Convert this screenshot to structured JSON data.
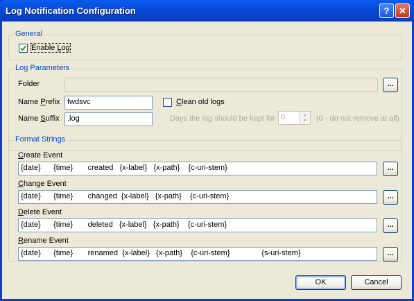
{
  "window": {
    "title": "Log Notification Configuration",
    "help_label": "?",
    "close_label": "✕"
  },
  "general": {
    "legend": "General",
    "enable_log_label": "Enable Log",
    "enable_log_checked": true
  },
  "log_parameters": {
    "legend": "Log Parameters",
    "folder_label": "Folder",
    "folder_value": "",
    "name_prefix_label": "Name Prefix",
    "name_prefix_value": "fwdsvc",
    "name_suffix_label": "Name Suffix",
    "name_suffix_value": ".log",
    "clean_old_logs_label": "Clean old logs",
    "clean_old_logs_checked": false,
    "days_label": "Days the log should be kept for",
    "days_value": "0",
    "days_hint": "(0 - do not remove at all)"
  },
  "format_strings": {
    "legend": "Format Strings",
    "items": [
      {
        "label": "Create Event",
        "value": "{date}      {time}       created   {x-label}   {x-path}    {c-uri-stem}"
      },
      {
        "label": "Change Event",
        "value": "{date}      {time}       changed  {x-label}   {x-path}    {c-uri-stem}"
      },
      {
        "label": "Delete Event",
        "value": "{date}      {time}       deleted   {x-label}   {x-path}    {c-uri-stem}"
      },
      {
        "label": "Rename Event",
        "value": "{date}      {time}       renamed  {x-label}   {x-path}    {c-uri-stem}               {s-uri-stem}"
      }
    ]
  },
  "browse_label": "...",
  "buttons": {
    "ok": "OK",
    "cancel": "Cancel"
  }
}
